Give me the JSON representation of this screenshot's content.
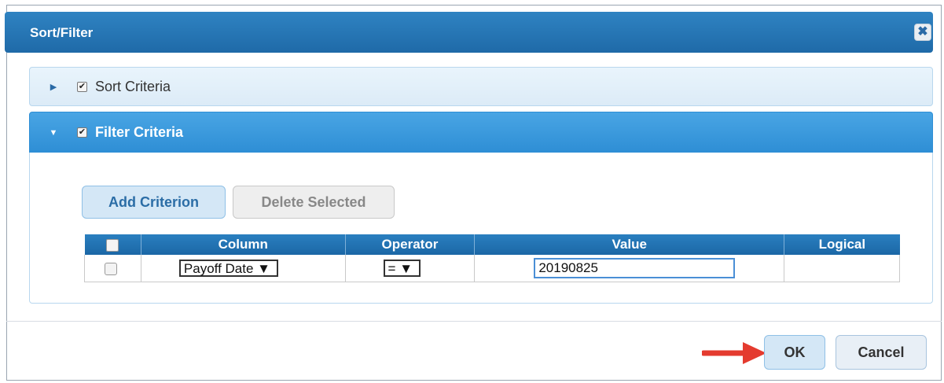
{
  "dialog": {
    "title": "Sort/Filter",
    "close_icon": "close-icon",
    "close_glyph": "✖"
  },
  "sections": {
    "sort": {
      "label": "Sort Criteria",
      "checked": true,
      "expanded": false
    },
    "filter": {
      "label": "Filter Criteria",
      "checked": true,
      "expanded": true
    }
  },
  "filter": {
    "add_button": "Add Criterion",
    "delete_button": "Delete Selected",
    "columns": [
      "Column",
      "Operator",
      "Value",
      "Logical"
    ],
    "rows": [
      {
        "column": "Payoff Date",
        "operator": "=",
        "value": "20190825",
        "logical": ""
      }
    ]
  },
  "footer": {
    "ok_label": "OK",
    "cancel_label": "Cancel"
  },
  "colors": {
    "titlebar": "#2a76b8",
    "filter_header": "#3a97dc",
    "annotation_arrow": "#e43b2f"
  }
}
